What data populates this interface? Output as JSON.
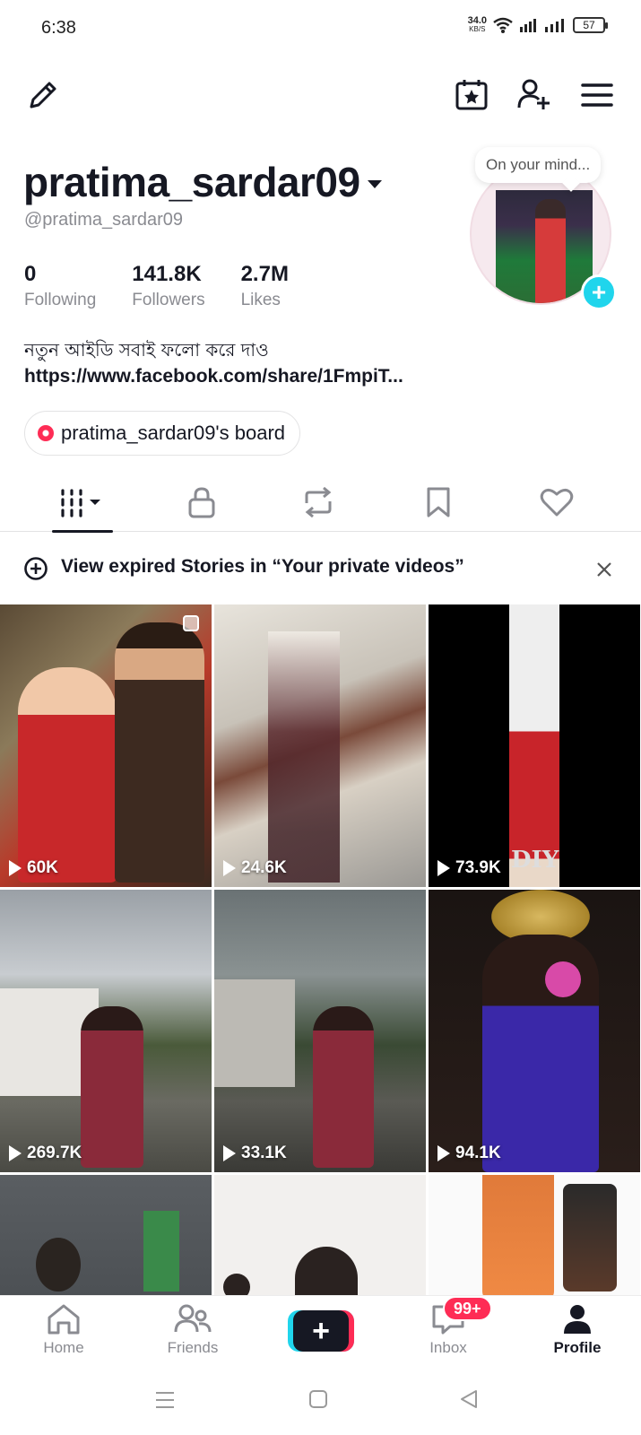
{
  "status_bar": {
    "time": "6:38",
    "speed": "34.0",
    "speed_unit": "KB/S",
    "battery": "57"
  },
  "profile": {
    "username": "pratima_sardar09",
    "handle": "@pratima_sardar09",
    "bubble_text": "On your mind...",
    "stats": [
      {
        "value": "0",
        "label": "Following"
      },
      {
        "value": "141.8K",
        "label": "Followers"
      },
      {
        "value": "2.7M",
        "label": "Likes"
      }
    ],
    "bio_line1": "নতুন আইডি সবাই ফলো করে দাও",
    "bio_link": "https://www.facebook.com/share/1FmpiT...",
    "board_label": "pratima_sardar09's board"
  },
  "banner": {
    "text": "View expired Stories in “Your private videos”"
  },
  "videos": [
    {
      "views": "60K"
    },
    {
      "views": "24.6K"
    },
    {
      "views": "73.9K",
      "overlay_text": "DIY"
    },
    {
      "views": "269.7K"
    },
    {
      "views": "33.1K"
    },
    {
      "views": "94.1K"
    },
    {
      "views": ""
    },
    {
      "views": ""
    },
    {
      "views": ""
    }
  ],
  "bottom_nav": {
    "home": "Home",
    "friends": "Friends",
    "inbox": "Inbox",
    "inbox_badge": "99+",
    "profile": "Profile"
  },
  "colors": {
    "accent_red": "#fe2c55",
    "accent_cyan": "#20d5ec",
    "text": "#161823",
    "secondary": "#8a8b91"
  }
}
